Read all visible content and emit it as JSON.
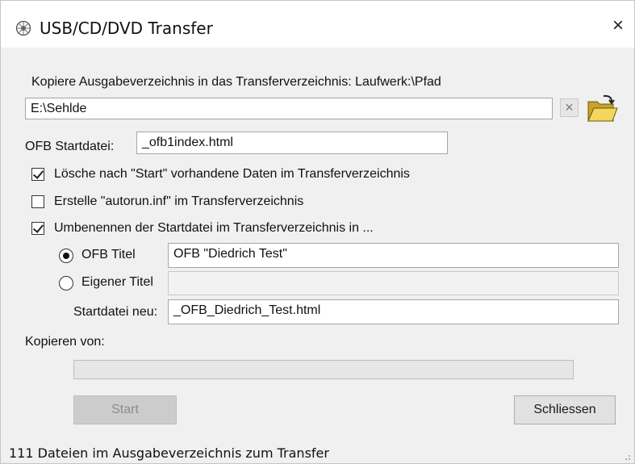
{
  "window": {
    "title": "USB/CD/DVD Transfer",
    "close_label": "×"
  },
  "copy_path": {
    "label": "Kopiere Ausgabeverzeichnis in das Transferverzeichnis: Laufwerk:\\Pfad",
    "value": "E:\\Sehlde",
    "clear_label": "×"
  },
  "start_file": {
    "label": "OFB Startdatei:",
    "value": "_ofb1index.html"
  },
  "options": {
    "delete_existing": {
      "label": "Lösche nach \"Start\" vorhandene Daten im Transferverzeichnis",
      "checked": true
    },
    "create_autorun": {
      "label": "Erstelle \"autorun.inf\" im Transferverzeichnis",
      "checked": false
    },
    "rename_start": {
      "label": "Umbenennen der Startdatei im Transferverzeichnis in ...",
      "checked": true
    }
  },
  "rename": {
    "ofb_title": {
      "label": "OFB Titel",
      "value": "OFB \"Diedrich Test\"",
      "selected": true
    },
    "own_title": {
      "label": "Eigener Titel",
      "value": "",
      "selected": false
    },
    "new_start_file": {
      "label": "Startdatei neu:",
      "value": "_OFB_Diedrich_Test.html"
    }
  },
  "progress": {
    "label": "Kopieren von:",
    "value": 0
  },
  "buttons": {
    "start": "Start",
    "close": "Schliessen"
  },
  "status": {
    "text": "111 Dateien im Ausgabeverzeichnis zum Transfer"
  }
}
